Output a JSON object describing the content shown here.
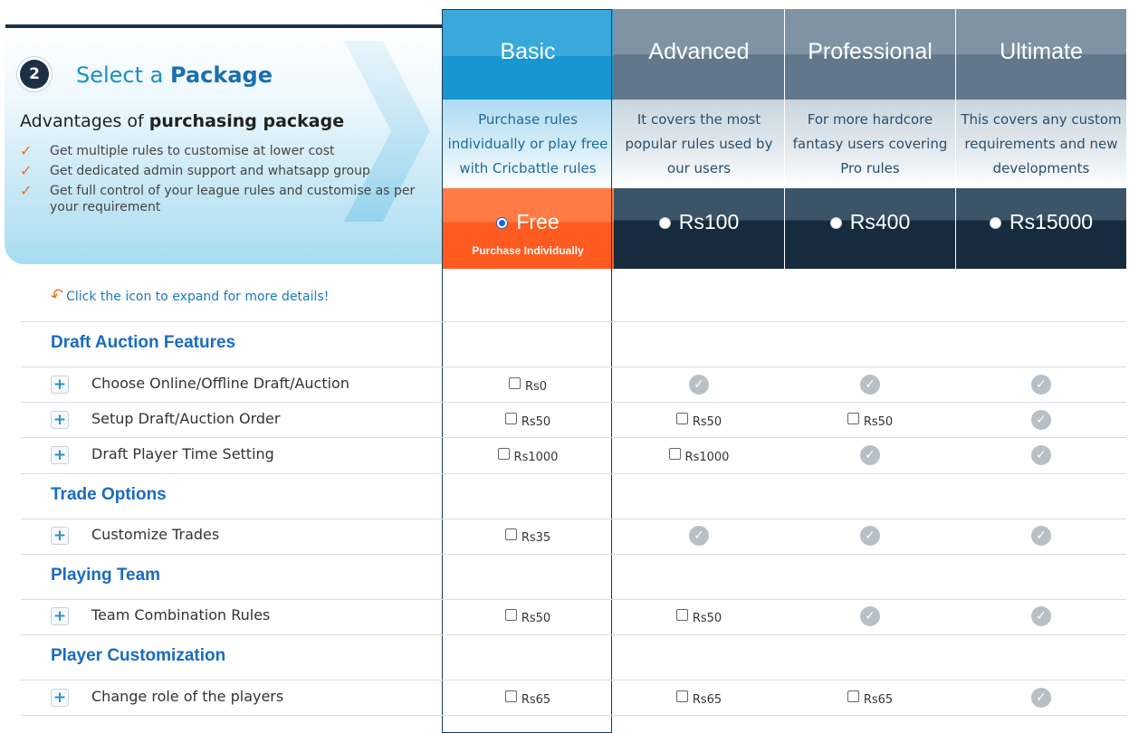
{
  "intro": {
    "step": "2",
    "select_prefix": "Select a",
    "select_bold": "Package",
    "adv_prefix": "Advantages of",
    "adv_bold": "purchasing package",
    "advantages": [
      "Get multiple rules to customise at lower cost",
      "Get dedicated admin support and whatsapp group",
      "Get full control of your league rules and customise as per your requirement"
    ]
  },
  "packages": [
    {
      "name": "Basic",
      "desc": "Purchase rules individually or play free with Cricbattle rules",
      "price": "Free",
      "sub": "Purchase Individually",
      "selected": true
    },
    {
      "name": "Advanced",
      "desc": "It covers the most popular rules used by our users",
      "price": "Rs100",
      "sub": "",
      "selected": false
    },
    {
      "name": "Professional",
      "desc": "For more hardcore fantasy users covering Pro rules",
      "price": "Rs400",
      "sub": "",
      "selected": false
    },
    {
      "name": "Ultimate",
      "desc": "This covers any custom requirements and new developments",
      "price": "Rs15000",
      "sub": "",
      "selected": false
    }
  ],
  "hint": "Click the icon to expand for more details!",
  "sections": [
    {
      "title": "Draft Auction Features",
      "rows": [
        {
          "label": "Choose Online/Offline Draft/Auction",
          "cells": [
            "Rs0",
            "check",
            "check",
            "check"
          ]
        },
        {
          "label": "Setup Draft/Auction Order",
          "cells": [
            "Rs50",
            "Rs50",
            "Rs50",
            "check"
          ]
        },
        {
          "label": "Draft Player Time Setting",
          "cells": [
            "Rs1000",
            "Rs1000",
            "check",
            "check"
          ]
        }
      ]
    },
    {
      "title": "Trade Options",
      "rows": [
        {
          "label": "Customize Trades",
          "cells": [
            "Rs35",
            "check",
            "check",
            "check"
          ]
        }
      ]
    },
    {
      "title": "Playing Team",
      "rows": [
        {
          "label": "Team Combination Rules",
          "cells": [
            "Rs50",
            "Rs50",
            "check",
            "check"
          ]
        }
      ]
    },
    {
      "title": "Player Customization",
      "rows": [
        {
          "label": "Change role of the players",
          "cells": [
            "Rs65",
            "Rs65",
            "Rs65",
            "check"
          ]
        }
      ]
    }
  ],
  "colors": {
    "accent": "#1a6bbf",
    "basic": "#1796d2",
    "free": "#ff5a1f",
    "dark": "#172b3f",
    "tick": "#f26b1d"
  }
}
